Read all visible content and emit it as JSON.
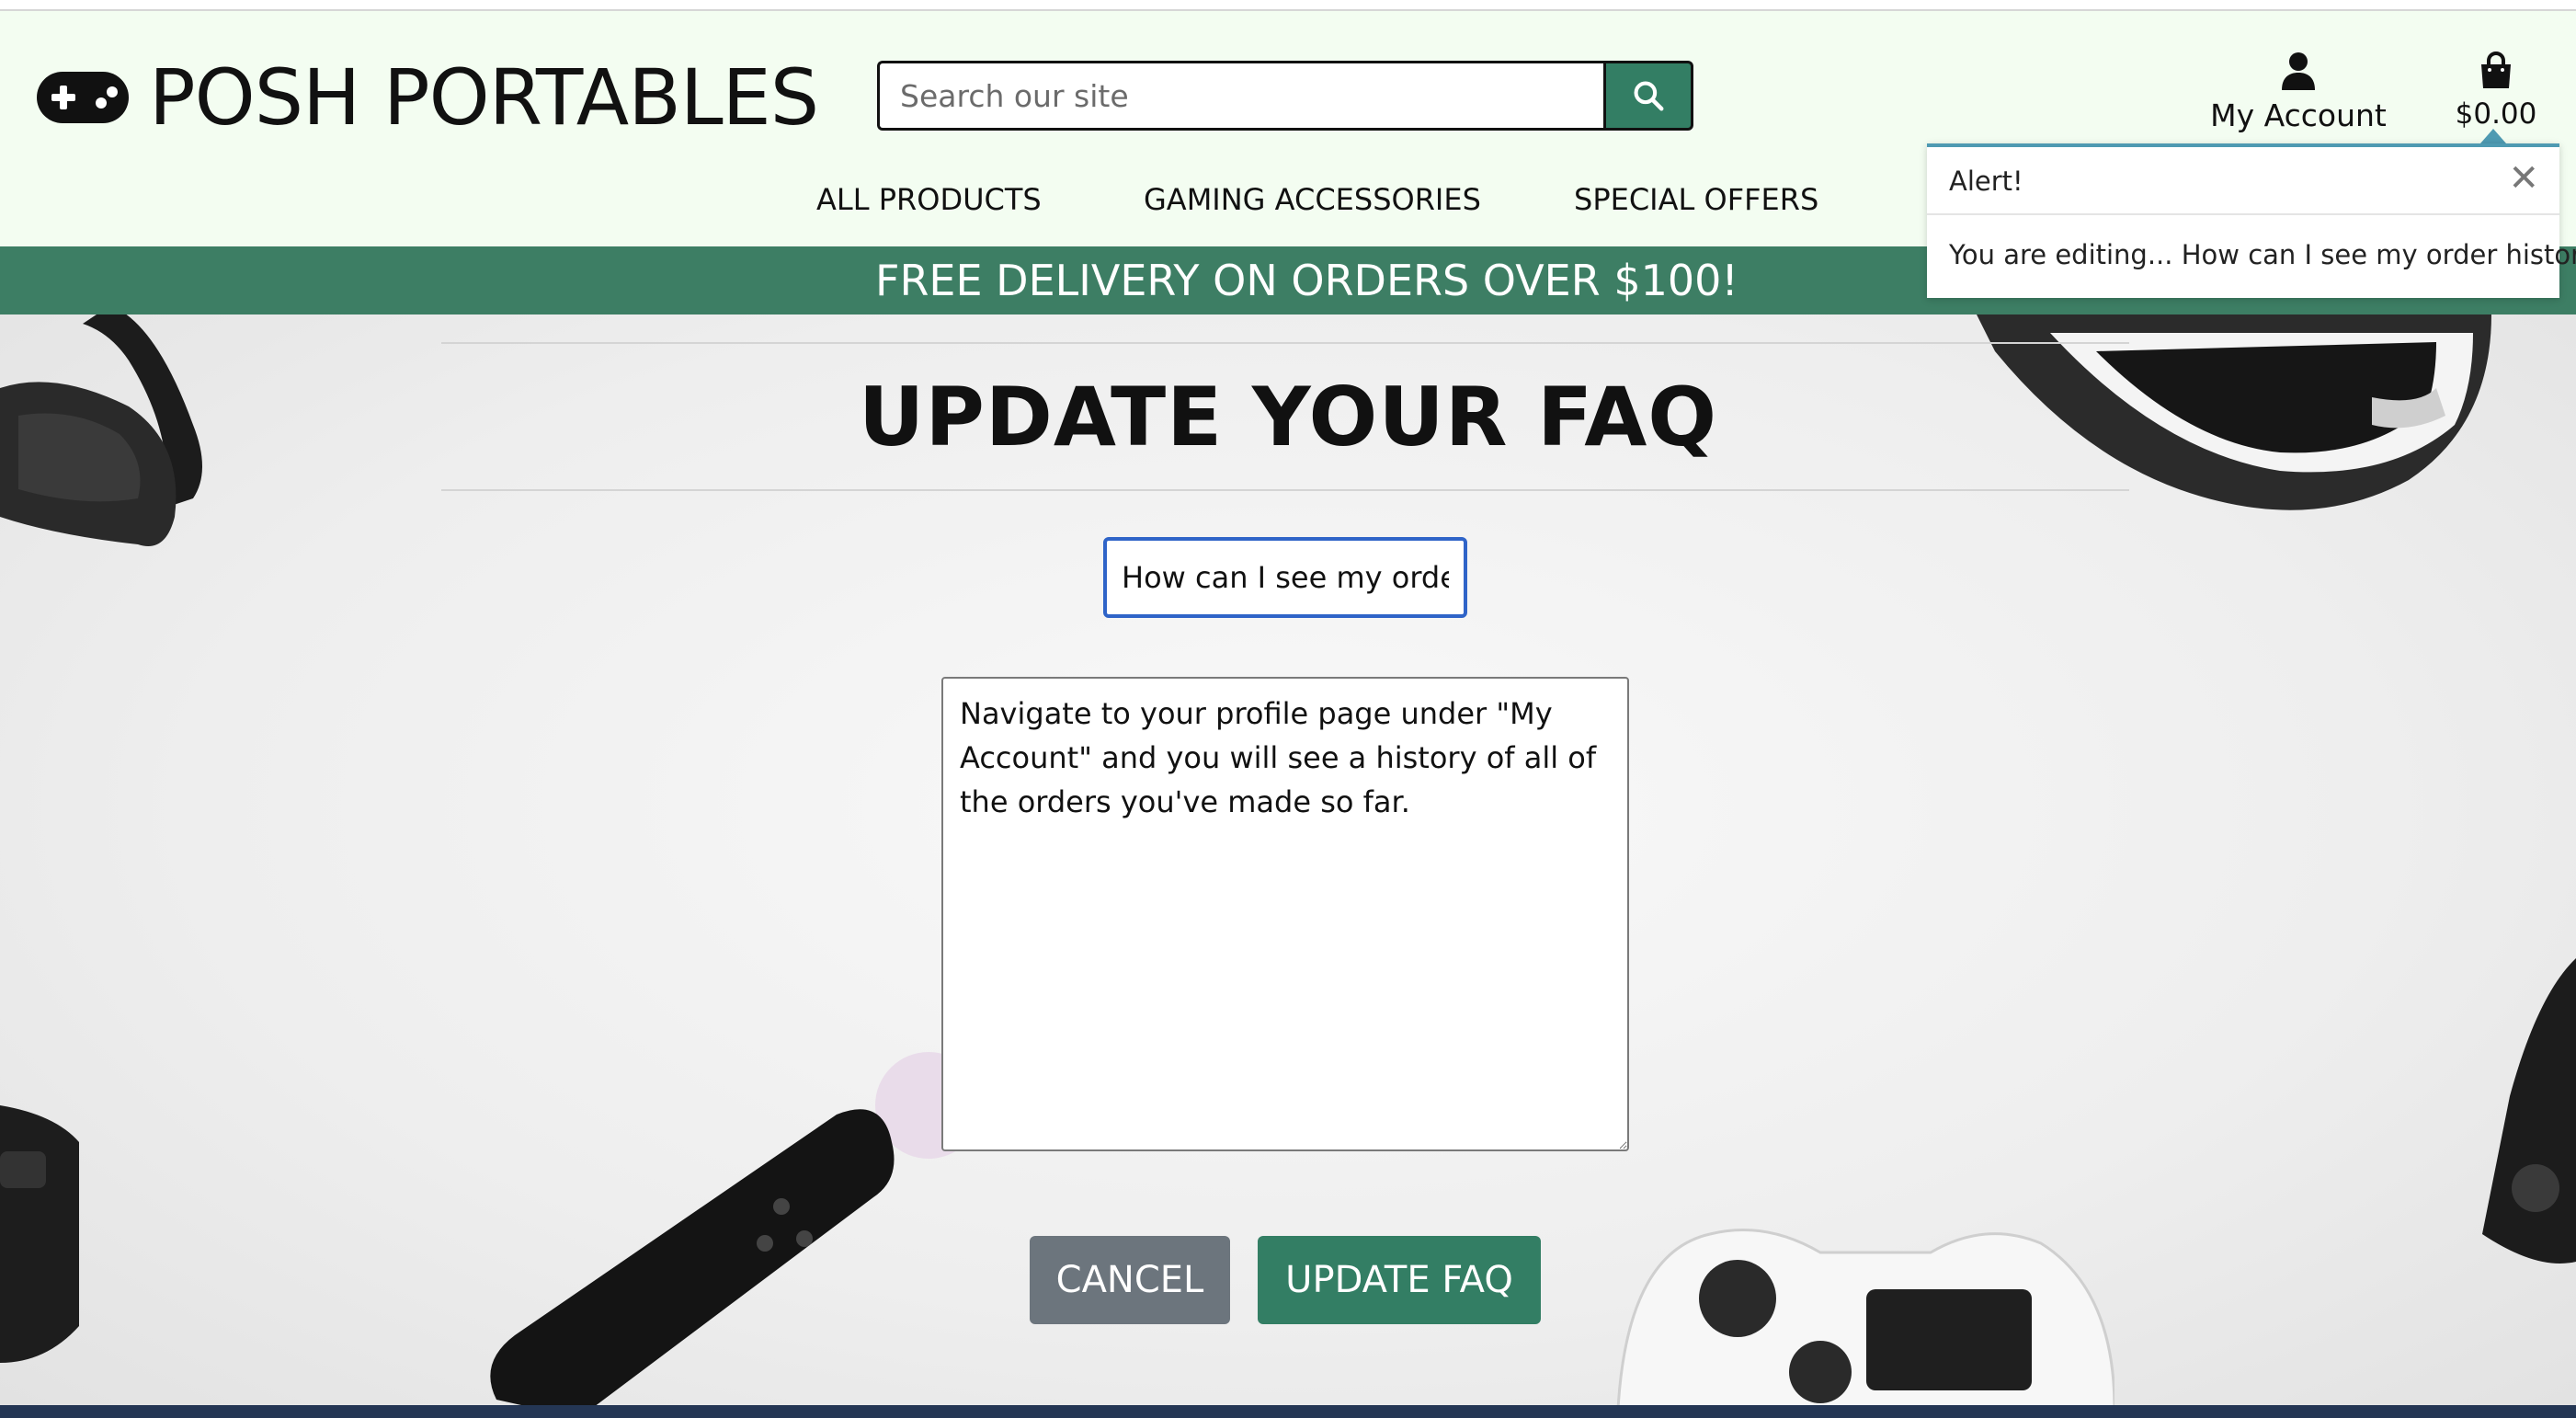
{
  "brand": {
    "name": "POSH PORTABLES",
    "icon": "gamepad-icon"
  },
  "search": {
    "placeholder": "Search our site",
    "value": "",
    "icon": "search-icon"
  },
  "account": {
    "label": "My Account",
    "icon": "user-icon"
  },
  "cart": {
    "total": "$0.00",
    "icon": "shopping-bag-icon"
  },
  "nav": {
    "items": [
      {
        "label": "ALL PRODUCTS"
      },
      {
        "label": "GAMING ACCESSORIES"
      },
      {
        "label": "SPECIAL OFFERS"
      }
    ]
  },
  "banner": {
    "text": "FREE DELIVERY ON ORDERS OVER $100!"
  },
  "page": {
    "title": "UPDATE YOUR FAQ"
  },
  "form": {
    "question_value": "How can I see my order history?",
    "answer_value": "Navigate to your profile page under \"My Account\" and you will see a history of all of the orders you've made so far.",
    "cancel_label": "CANCEL",
    "submit_label": "UPDATE FAQ"
  },
  "alert": {
    "title": "Alert!",
    "message": "You are editing... How can I see my order history?",
    "close_icon": "close-icon"
  },
  "colors": {
    "header_bg": "#f3fdf1",
    "brand_green": "#337e64",
    "banner_green": "#3d7e64",
    "cancel_grey": "#6c757d",
    "input_focus_blue": "#2f64c8",
    "alert_accent": "#4e9ab2",
    "footer_navy": "#243654"
  }
}
